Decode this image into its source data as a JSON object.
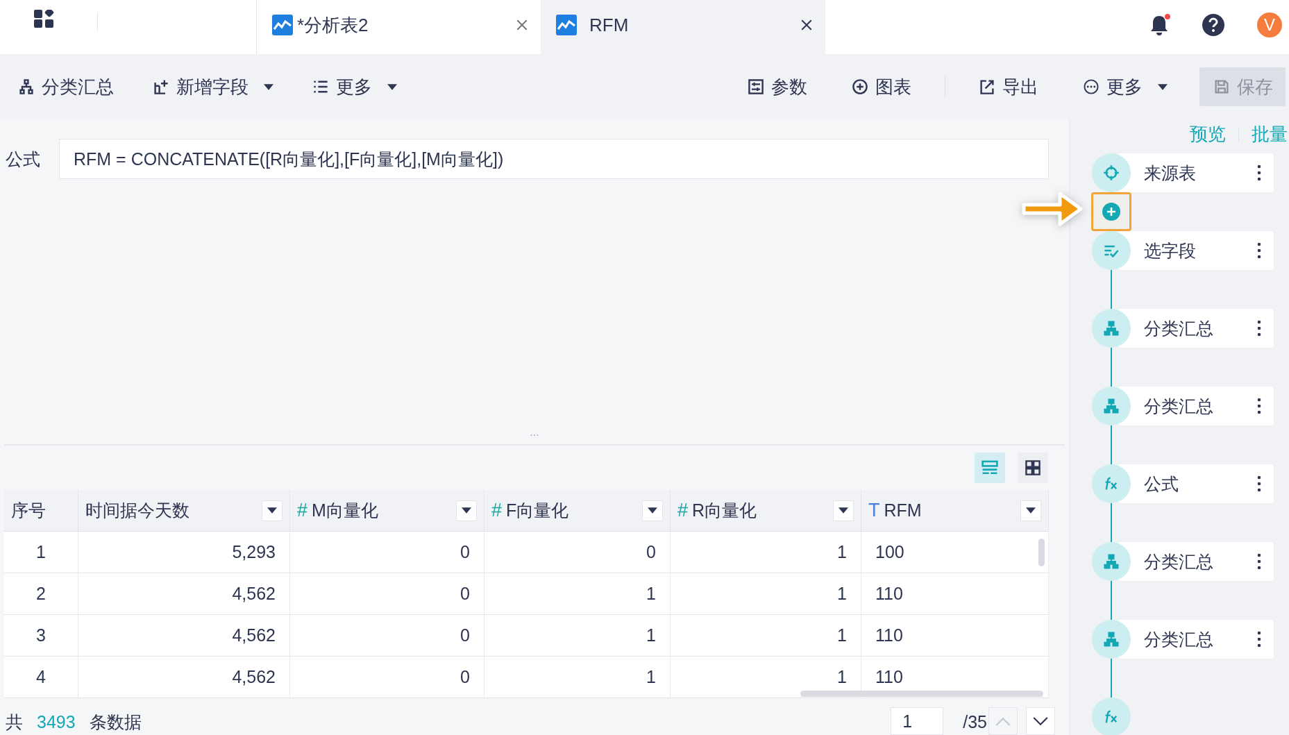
{
  "tabs": [
    {
      "title": "*分析表2",
      "selected": false
    },
    {
      "title": "RFM",
      "selected": true
    }
  ],
  "header": {
    "notification_dot": true,
    "avatar": "V"
  },
  "toolbar": {
    "left": [
      {
        "label": "分类汇总",
        "kind": "group"
      },
      {
        "label": "新增字段",
        "kind": "add_field",
        "dropdown": true
      },
      {
        "label": "更多",
        "kind": "list",
        "dropdown": true
      }
    ],
    "right_groups": [
      {
        "items": [
          {
            "label": "参数",
            "kind": "params"
          },
          {
            "label": "图表",
            "kind": "chart"
          }
        ]
      },
      {
        "items": [
          {
            "label": "导出",
            "kind": "export"
          },
          {
            "label": "更多",
            "kind": "more",
            "dropdown": true
          },
          {
            "label": "保存",
            "kind": "save",
            "disabled": true
          }
        ]
      }
    ]
  },
  "formula": {
    "label": "公式",
    "value": "RFM = CONCATENATE([R向量化],[F向量化],[M向量化])"
  },
  "editor": {
    "resize_handle": "..."
  },
  "view_toggles": [
    {
      "kind": "list",
      "selected": true
    },
    {
      "kind": "grid",
      "selected": false
    }
  ],
  "table": {
    "columns": [
      {
        "label": "序号",
        "kind": "index"
      },
      {
        "label": "时间据今天数",
        "kind": "number",
        "dropdown": true
      },
      {
        "label": "M向量化",
        "kind": "number",
        "mark": "#",
        "dropdown": true
      },
      {
        "label": "F向量化",
        "kind": "number",
        "mark": "#",
        "dropdown": true
      },
      {
        "label": "R向量化",
        "kind": "number",
        "mark": "#",
        "dropdown": true
      },
      {
        "label": "RFM",
        "kind": "text",
        "mark": "T",
        "dropdown": true
      }
    ],
    "rows": [
      [
        "1",
        "5,293",
        "0",
        "0",
        "1",
        "100"
      ],
      [
        "2",
        "4,562",
        "0",
        "1",
        "1",
        "110"
      ],
      [
        "3",
        "4,562",
        "0",
        "1",
        "1",
        "110"
      ],
      [
        "4",
        "4,562",
        "0",
        "1",
        "1",
        "110"
      ]
    ]
  },
  "footer": {
    "prefix": "共",
    "count": "3493",
    "suffix": "条数据",
    "page": "1",
    "page_total": "/35",
    "prev_disabled": true,
    "next_disabled": false
  },
  "sidebar": {
    "links": [
      "预览",
      "批量"
    ],
    "steps": [
      {
        "kind": "source",
        "label": "来源表"
      },
      {
        "kind": "insert",
        "highlighted": true
      },
      {
        "kind": "select",
        "label": "选字段"
      },
      {
        "kind": "group",
        "label": "分类汇总"
      },
      {
        "kind": "group",
        "label": "分类汇总"
      },
      {
        "kind": "formula",
        "label": "公式"
      },
      {
        "kind": "group",
        "label": "分类汇总"
      },
      {
        "kind": "group",
        "label": "分类汇总"
      },
      {
        "kind": "formula_partial"
      }
    ]
  }
}
